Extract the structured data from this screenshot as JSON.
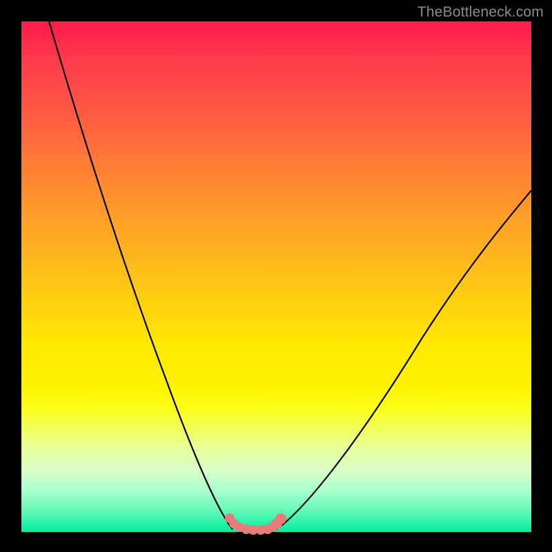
{
  "watermark": "TheBottleneck.com",
  "colors": {
    "background": "#000000",
    "curve_stroke": "#000000",
    "dots_fill": "#e77d7a",
    "gradient_top": "#ff1a4a",
    "gradient_bottom": "#00eda0"
  },
  "chart_data": {
    "type": "line",
    "title": "",
    "xlabel": "",
    "ylabel": "",
    "xlim": [
      0,
      100
    ],
    "ylim": [
      0,
      100
    ],
    "series": [
      {
        "name": "left-curve",
        "x": [
          5.5,
          8,
          11,
          14,
          17,
          20,
          23,
          26,
          28.5,
          30.5,
          32.5,
          34,
          35.5,
          37,
          38.5,
          40,
          41.5
        ],
        "y": [
          100,
          90,
          80,
          70,
          60,
          50,
          41,
          32,
          25,
          19,
          14,
          10,
          7,
          4.5,
          2.6,
          1.3,
          0.5
        ]
      },
      {
        "name": "right-curve",
        "x": [
          50,
          52,
          54.5,
          57.5,
          61,
          65,
          69.5,
          74.5,
          80,
          86,
          92,
          98,
          100
        ],
        "y": [
          0.5,
          1.5,
          3.5,
          6.5,
          10.5,
          16,
          22,
          29,
          37,
          46,
          55,
          64,
          67
        ]
      },
      {
        "name": "valley-dots",
        "x": [
          40.8,
          41.7,
          42.7,
          44.0,
          45.5,
          47.0,
          48.3,
          49.2,
          50.0,
          50.8
        ],
        "y": [
          2.8,
          1.8,
          1.0,
          0.5,
          0.5,
          0.5,
          0.6,
          1.1,
          1.8,
          2.7
        ]
      }
    ],
    "annotations": [
      {
        "text": "TheBottleneck.com",
        "position": "top-right"
      }
    ]
  }
}
